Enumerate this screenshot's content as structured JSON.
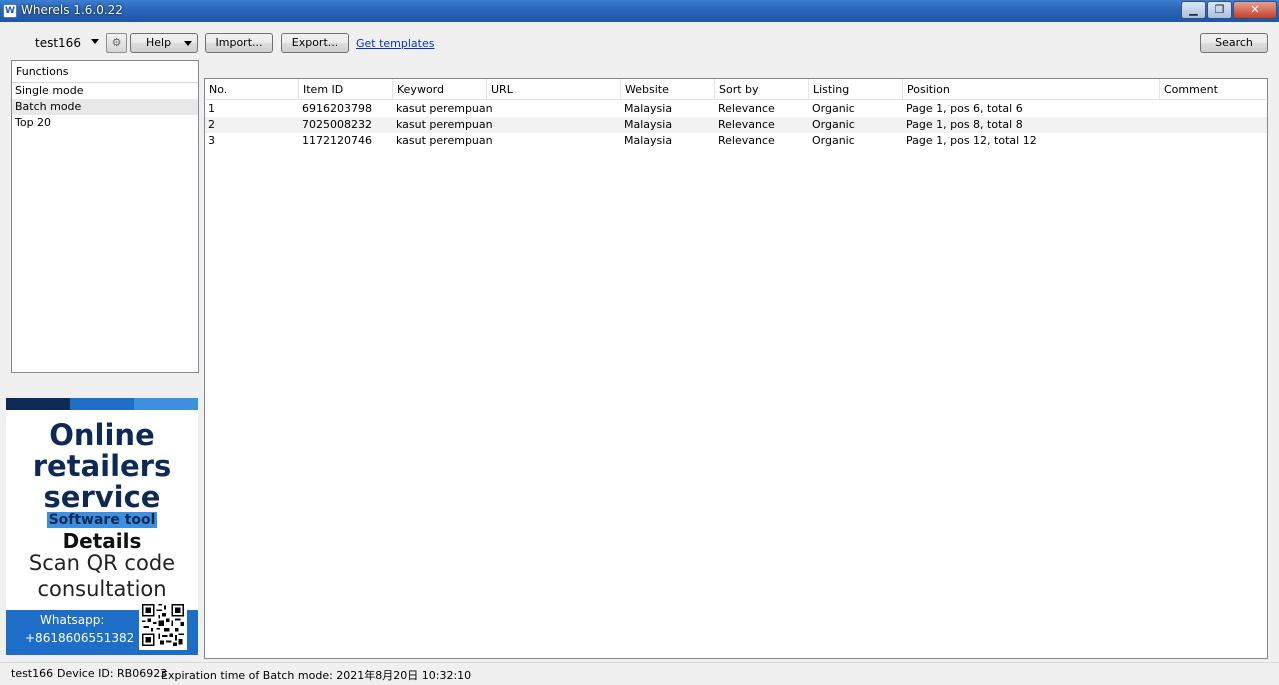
{
  "window": {
    "title": "Wherels 1.6.0.22",
    "min": "▁",
    "max": "❐",
    "close": "✕"
  },
  "toolbar": {
    "user": "test166",
    "settings_icon": "gear-icon",
    "settings_glyph": "⚙",
    "help_label": "Help",
    "import_label": "Import...",
    "export_label": "Export...",
    "templates_link": "Get templates",
    "search_label": "Search"
  },
  "functions": {
    "header": "Functions",
    "items": [
      "Single mode",
      "Batch mode",
      "Top 20"
    ],
    "selected_index": 1
  },
  "ad": {
    "line1": "Online",
    "line2": "retailers",
    "line3": "service",
    "line4": "Software tool",
    "line5": "Details",
    "line6": "Scan QR code",
    "line7": "consultation",
    "whatsapp_label": "Whatsapp:",
    "whatsapp_number": "+8618606551382",
    "colors": {
      "dark": "#0c2a55",
      "mid": "#1e6ec7",
      "light": "#3d8fe0"
    }
  },
  "table": {
    "columns": [
      "No.",
      "Item ID",
      "Keyword",
      "URL",
      "Website",
      "Sort by",
      "Listing",
      "Position",
      "Comment"
    ],
    "rows": [
      [
        "1",
        "6916203798",
        "kasut perempuan",
        "",
        "Malaysia",
        "Relevance",
        "Organic",
        "Page 1, pos 6, total 6",
        ""
      ],
      [
        "2",
        "7025008232",
        "kasut perempuan",
        "",
        "Malaysia",
        "Relevance",
        "Organic",
        "Page 1, pos 8, total 8",
        ""
      ],
      [
        "3",
        "1172120746",
        "kasut perempuan",
        "",
        "Malaysia",
        "Relevance",
        "Organic",
        "Page 1, pos 12, total 12",
        ""
      ]
    ]
  },
  "status": {
    "user": "test166",
    "device": "Device ID: RB06923",
    "expiration": "Expiration time of Batch mode: 2021年8月20日 10:32:10"
  }
}
